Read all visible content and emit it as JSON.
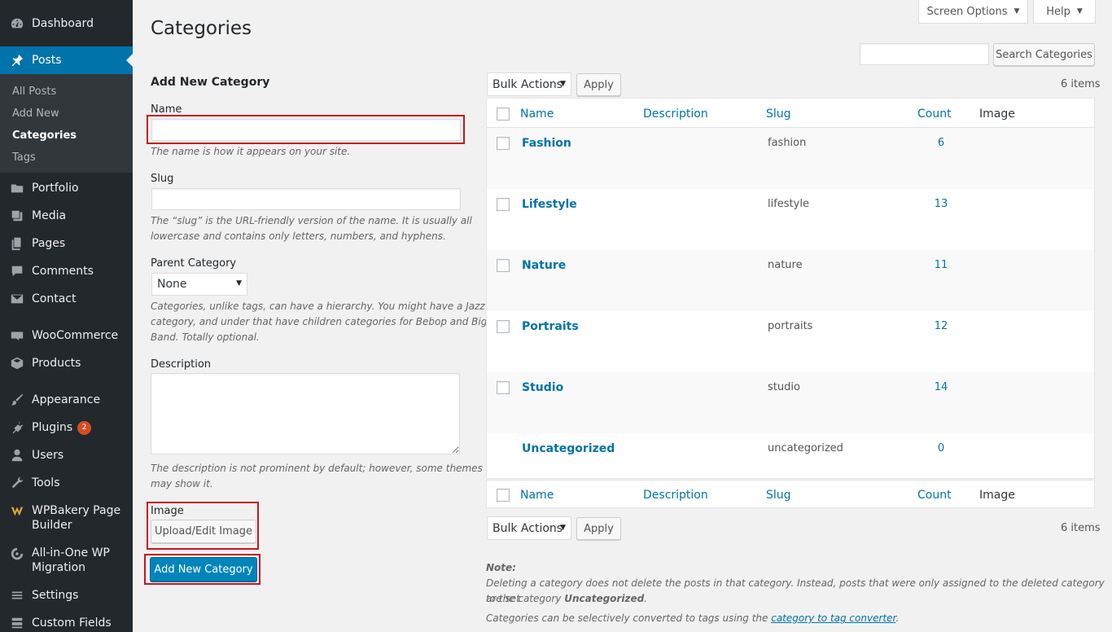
{
  "sidebar": {
    "items": [
      {
        "label": "Dashboard",
        "icon": "dashboard-icon"
      },
      {
        "label": "Posts",
        "icon": "pin-icon"
      },
      {
        "label": "Portfolio",
        "icon": "folder-icon"
      },
      {
        "label": "Media",
        "icon": "media-icon"
      },
      {
        "label": "Pages",
        "icon": "pages-icon"
      },
      {
        "label": "Comments",
        "icon": "comment-icon"
      },
      {
        "label": "Contact",
        "icon": "mail-icon"
      },
      {
        "label": "WooCommerce",
        "icon": "woo-icon"
      },
      {
        "label": "Products",
        "icon": "box-icon"
      },
      {
        "label": "Appearance",
        "icon": "brush-icon"
      },
      {
        "label": "Plugins",
        "icon": "plug-icon",
        "badge": "2"
      },
      {
        "label": "Users",
        "icon": "user-icon"
      },
      {
        "label": "Tools",
        "icon": "wrench-icon"
      },
      {
        "label": "WPBakery Page Builder",
        "icon": "wpbakery-icon"
      },
      {
        "label": "All-in-One WP Migration",
        "icon": "migration-icon"
      },
      {
        "label": "Settings",
        "icon": "settings-icon"
      },
      {
        "label": "Custom Fields",
        "icon": "fields-icon"
      }
    ],
    "submenu": [
      "All Posts",
      "Add New",
      "Categories",
      "Tags"
    ]
  },
  "header": {
    "title": "Categories",
    "screen_options": "Screen Options",
    "help": "Help"
  },
  "search": {
    "button": "Search Categories",
    "value": ""
  },
  "form": {
    "heading": "Add New Category",
    "name_label": "Name",
    "name_value": "",
    "name_desc": "The name is how it appears on your site.",
    "slug_label": "Slug",
    "slug_value": "",
    "slug_desc_1": "The “slug” is the URL-friendly version of the name. It is usually all",
    "slug_desc_2": "lowercase and contains only letters, numbers, and hyphens.",
    "parent_label": "Parent Category",
    "parent_value": "None",
    "parent_desc_1": "Categories, unlike tags, can have a hierarchy. You might have a Jazz",
    "parent_desc_2": "category, and under that have children categories for Bebop and Big",
    "parent_desc_3": "Band. Totally optional.",
    "description_label": "Description",
    "description_value": "",
    "description_desc_1": "The description is not prominent by default; however, some themes",
    "description_desc_2": "may show it.",
    "image_label": "Image",
    "image_button": "Upload/Edit Image",
    "submit": "Add New Category"
  },
  "bulk": {
    "label": "Bulk Actions",
    "apply": "Apply",
    "count": "6 items"
  },
  "table": {
    "headers": {
      "name": "Name",
      "description": "Description",
      "slug": "Slug",
      "count": "Count",
      "image": "Image"
    },
    "rows": [
      {
        "name": "Fashion",
        "slug": "fashion",
        "count": "6",
        "checkbox": true
      },
      {
        "name": "Lifestyle",
        "slug": "lifestyle",
        "count": "13",
        "checkbox": true
      },
      {
        "name": "Nature",
        "slug": "nature",
        "count": "11",
        "checkbox": true
      },
      {
        "name": "Portraits",
        "slug": "portraits",
        "count": "12",
        "checkbox": true
      },
      {
        "name": "Studio",
        "slug": "studio",
        "count": "14",
        "checkbox": true
      },
      {
        "name": "Uncategorized",
        "slug": "uncategorized",
        "count": "0",
        "checkbox": false
      }
    ]
  },
  "note": {
    "title": "Note:",
    "line1": "Deleting a category does not delete the posts in that category. Instead, posts that were only assigned to the deleted category are set",
    "line2_prefix": "to the category ",
    "line2_bold": "Uncategorized",
    "line2_suffix": ".",
    "line3_prefix": "Categories can be selectively converted to tags using the ",
    "line3_link": "category to tag converter",
    "line3_suffix": "."
  },
  "colors": {
    "sidebar": "#23282d",
    "accent": "#0073aa",
    "primary_button": "#0085ba",
    "highlight": "#c9151e",
    "badge": "#d54e21"
  }
}
